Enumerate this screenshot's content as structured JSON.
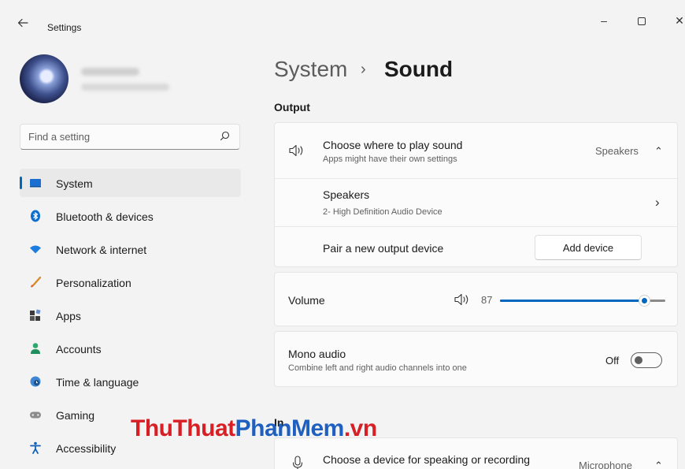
{
  "window": {
    "title": "Settings",
    "controls": {
      "minimize": "–",
      "close": "✕"
    }
  },
  "search": {
    "placeholder": "Find a setting"
  },
  "nav": {
    "items": [
      {
        "label": "System",
        "icon": "monitor-icon",
        "active": true
      },
      {
        "label": "Bluetooth & devices",
        "icon": "bluetooth-icon"
      },
      {
        "label": "Network & internet",
        "icon": "wifi-icon"
      },
      {
        "label": "Personalization",
        "icon": "brush-icon"
      },
      {
        "label": "Apps",
        "icon": "apps-icon"
      },
      {
        "label": "Accounts",
        "icon": "person-icon"
      },
      {
        "label": "Time & language",
        "icon": "globe-clock-icon"
      },
      {
        "label": "Gaming",
        "icon": "gamepad-icon"
      },
      {
        "label": "Accessibility",
        "icon": "accessibility-icon"
      }
    ]
  },
  "breadcrumb": {
    "parent": "System",
    "separator": "›",
    "current": "Sound"
  },
  "output": {
    "section_title": "Output",
    "choose": {
      "title": "Choose where to play sound",
      "subtitle": "Apps might have their own settings",
      "value": "Speakers",
      "chevron": "⌃"
    },
    "device": {
      "title": "Speakers",
      "subtitle": "2- High Definition Audio Device",
      "chevron": "›"
    },
    "pair": {
      "label": "Pair a new output device",
      "button": "Add device"
    }
  },
  "volume": {
    "label": "Volume",
    "value": "87",
    "level": 0.87
  },
  "mono": {
    "title": "Mono audio",
    "subtitle": "Combine left and right audio channels into one",
    "state": "Off"
  },
  "input": {
    "section_title_partial": "In",
    "choose": {
      "title": "Choose a device for speaking or recording",
      "value": "Microphone",
      "chevron": "⌃"
    }
  },
  "watermark": {
    "part1": "ThuThuat",
    "part2": "PhanMem",
    "part3": ".vn"
  },
  "colors": {
    "accent": "#0067c0",
    "background": "#f3f3f3",
    "card": "#fbfbfb"
  }
}
